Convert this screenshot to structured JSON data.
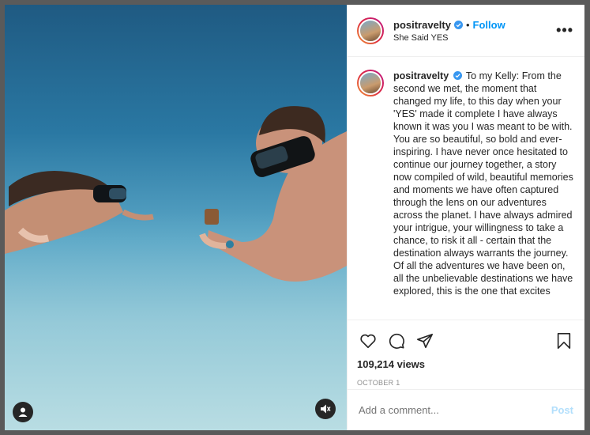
{
  "post": {
    "username": "positravelty",
    "follow_label": "Follow",
    "dot": "•",
    "location": "She Said YES",
    "more_label": "•••",
    "caption": "To my Kelly: From the second we met, the moment that changed my life, to this day when your 'YES' made it complete I have always known it was you I was meant to be with. You are so beautiful, so bold and ever-inspiring. I have never once hesitated to continue our journey together, a story now compiled of wild, beautiful memories and moments we have often captured through the lens on our adventures across the planet. I have always admired your intrigue, your willingness to take a chance, to risk it all - certain that the destination always warrants the journey. Of all the adventures we have been on, all the unbelievable destinations we have explored, this is the one that excites",
    "views": "109,214 views",
    "date": "OCTOBER 1"
  },
  "comment": {
    "placeholder": "Add a comment...",
    "post_label": "Post"
  },
  "colors": {
    "accent": "#0095f6",
    "post_disabled": "#b2dffc",
    "muted": "#8e8e8e"
  },
  "icons": [
    "heart-icon",
    "comment-icon",
    "share-icon",
    "bookmark-icon",
    "user-tag-icon",
    "mute-icon",
    "verified-icon"
  ]
}
